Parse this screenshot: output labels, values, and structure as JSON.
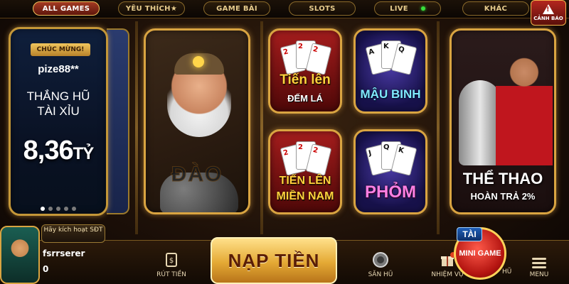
{
  "top_tabs": [
    {
      "label": "ALL GAMES",
      "active": true
    },
    {
      "label": "YÊU THÍCH★",
      "active": false
    },
    {
      "label": "GAME BÀI",
      "active": false
    },
    {
      "label": "SLOTS",
      "active": false
    },
    {
      "label": "LIVE",
      "active": false,
      "live_indicator_color": "#38e03b"
    },
    {
      "label": "KHÁC",
      "active": false
    }
  ],
  "warning": {
    "label": "CẢNH BÁO",
    "icon": "warning-icon"
  },
  "jackpot_panel": {
    "ribbon": "CHÚC MỪNG!",
    "username": "pize88**",
    "line1": "THẮNG HŨ",
    "line2": "TÀI XỈU",
    "amount": "8,36",
    "unit": "TỶ",
    "carousel_pages": 5,
    "carousel_active": 0
  },
  "games": {
    "miner": {
      "title": "ĐÀO"
    },
    "tien_len_dem_la": {
      "title": "Tiến lên",
      "subtitle": "ĐẾM LÁ"
    },
    "mau_binh": {
      "title": "MẬU BINH"
    },
    "tien_len_mien_nam": {
      "title": "TIẾN LÊN",
      "subtitle": "MIỀN NAM"
    },
    "phom": {
      "title": "PHỎM"
    },
    "sport": {
      "title": "THỂ THAO",
      "subtitle": "HOÀN TRẢ 2%"
    }
  },
  "player": {
    "activate_label": "Hãy kích hoạt SĐT",
    "username": "fsrrserer",
    "balance": "0"
  },
  "bottom_nav": {
    "withdraw": "RÚT TIỀN",
    "deposit": "NẠP TIỀN",
    "jackpot_hall": "SĂN HŨ",
    "missions": "NHIỆM VỤ",
    "mini_game_badge": "TÀI",
    "mini_game": "MINI GAME",
    "hu_label": "HŨ",
    "menu": "MENU"
  },
  "colors": {
    "accent_gold": "#d9a441",
    "active_tab": "#a33a22",
    "deposit_gold": "#e4a934"
  }
}
